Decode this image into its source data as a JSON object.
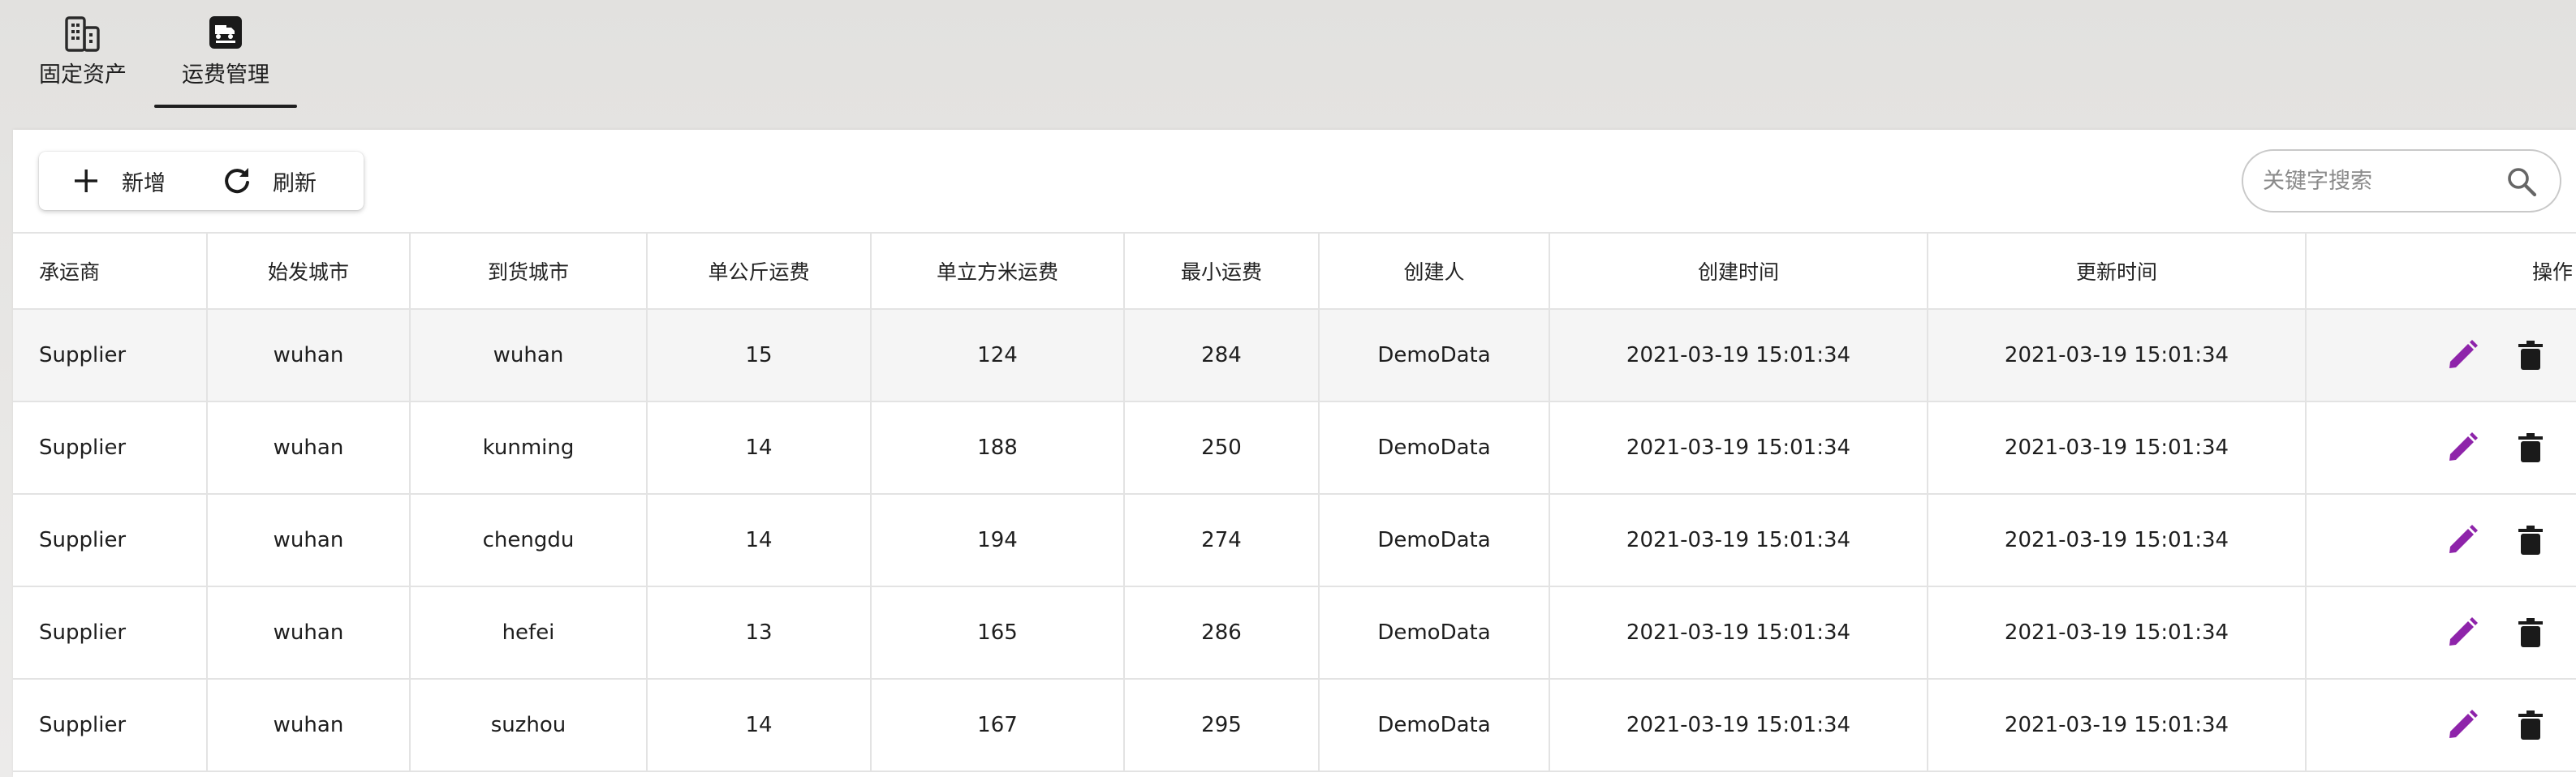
{
  "top_tabs": [
    {
      "label": "固定资产",
      "icon": "building-icon"
    },
    {
      "label": "运费管理",
      "icon": "freight-truck-icon",
      "active": true
    }
  ],
  "toolbar": {
    "add_label": "新增",
    "refresh_label": "刷新"
  },
  "search": {
    "placeholder": "关键字搜索",
    "value": ""
  },
  "table": {
    "columns": [
      "承运商",
      "始发城市",
      "到货城市",
      "单公斤运费",
      "单立方米运费",
      "最小运费",
      "创建人",
      "创建时间",
      "更新时间",
      "操作"
    ],
    "rows": [
      {
        "carrier": "Supplier",
        "from": "wuhan",
        "to": "wuhan",
        "per_kg": "15",
        "per_m3": "124",
        "min_fee": "284",
        "creator": "DemoData",
        "created": "2021-03-19 15:01:34",
        "updated": "2021-03-19 15:01:34"
      },
      {
        "carrier": "Supplier",
        "from": "wuhan",
        "to": "kunming",
        "per_kg": "14",
        "per_m3": "188",
        "min_fee": "250",
        "creator": "DemoData",
        "created": "2021-03-19 15:01:34",
        "updated": "2021-03-19 15:01:34"
      },
      {
        "carrier": "Supplier",
        "from": "wuhan",
        "to": "chengdu",
        "per_kg": "14",
        "per_m3": "194",
        "min_fee": "274",
        "creator": "DemoData",
        "created": "2021-03-19 15:01:34",
        "updated": "2021-03-19 15:01:34"
      },
      {
        "carrier": "Supplier",
        "from": "wuhan",
        "to": "hefei",
        "per_kg": "13",
        "per_m3": "165",
        "min_fee": "286",
        "creator": "DemoData",
        "created": "2021-03-19 15:01:34",
        "updated": "2021-03-19 15:01:34"
      },
      {
        "carrier": "Supplier",
        "from": "wuhan",
        "to": "suzhou",
        "per_kg": "14",
        "per_m3": "167",
        "min_fee": "295",
        "creator": "DemoData",
        "created": "2021-03-19 15:01:34",
        "updated": "2021-03-19 15:01:34"
      }
    ]
  },
  "colors": {
    "edit_icon": "#8e24aa",
    "delete_icon": "#1a1a1a",
    "zebra_row": "#f5f5f5"
  }
}
